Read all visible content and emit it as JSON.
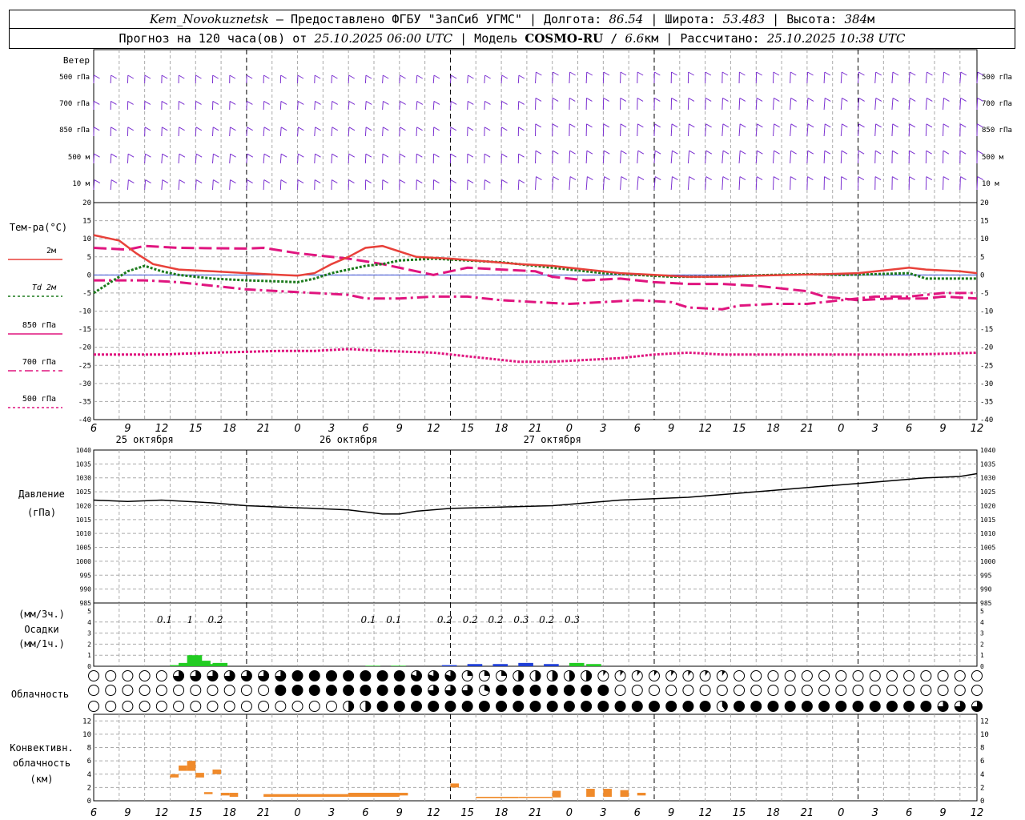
{
  "header": {
    "station": "Kem_Novokuznetsk",
    "provider": " — Предоставлено ФГБУ \"ЗапСиб УГМС\" | Долгота: ",
    "lon": "86.54",
    "lat_label": " | Широта: ",
    "lat": "53.483",
    "alt_label": " | Высота: ",
    "alt": "384",
    "alt_unit": "м",
    "line2_a": "Прогноз на 120 часа(ов) от ",
    "run_time": "25.10.2025 06:00 UTC",
    "line2_b": "  | Модель ",
    "model": "COSMO-RU",
    "line2_c": " / ",
    "res": "6.6",
    "res_unit": "км",
    "line2_d": " | Рассчитано: ",
    "calc_time": "25.10.2025 10:38 UTC"
  },
  "wind_panel": {
    "title": "Ветер",
    "levels": [
      "500 гПа",
      "700 гПа",
      "850 гПа",
      "500 м",
      "10 м"
    ],
    "color": "#7a2fd0"
  },
  "temp_panel": {
    "title": "Тем-ра(°C)",
    "ylim": [
      -40,
      20
    ],
    "ticks": [
      "20",
      "15",
      "10",
      "5",
      "0",
      "-5",
      "-10",
      "-15",
      "-20",
      "-25",
      "-30",
      "-35",
      "-40"
    ],
    "legend": [
      {
        "label": "2м",
        "prefix": "",
        "color": "#e8413a",
        "dash": "solid"
      },
      {
        "label": "2м",
        "prefix": "Td",
        "color": "#1c7a1c",
        "dash": "dot"
      },
      {
        "label": "гПа",
        "prefix": "850",
        "color": "#e0157f",
        "dash": "solid"
      },
      {
        "label": "гПа",
        "prefix": "700",
        "color": "#e0157f",
        "dash": "dashdot"
      },
      {
        "label": "гПа",
        "prefix": "500",
        "color": "#e0157f",
        "dash": "dot"
      }
    ]
  },
  "time_axis": {
    "hour_ticks": [
      "6",
      "9",
      "12",
      "15",
      "18",
      "21",
      "0",
      "3",
      "6",
      "9",
      "12",
      "15",
      "18",
      "21",
      "0",
      "3",
      "6",
      "9",
      "12",
      "15",
      "18",
      "21",
      "0",
      "3",
      "6",
      "9",
      "12"
    ],
    "days": [
      "25 октября",
      "26 октября",
      "27 октября"
    ]
  },
  "pressure_panel": {
    "title1": "Давление",
    "title2": "(гПа)",
    "ylim": [
      985,
      1040
    ],
    "ticks": [
      "1040",
      "1035",
      "1030",
      "1025",
      "1020",
      "1015",
      "1010",
      "1005",
      "1000",
      "995",
      "990",
      "985"
    ]
  },
  "precip_panel": {
    "title1": "(мм/3ч.)",
    "title2": "Осадки",
    "title3": "(мм/1ч.)",
    "ticks": [
      "5",
      "4",
      "3",
      "2",
      "1",
      "0"
    ],
    "amounts": [
      {
        "t": 9,
        "text": "0.1"
      },
      {
        "t": 12,
        "text": "1"
      },
      {
        "t": 15,
        "text": "0.2"
      },
      {
        "t": 33,
        "text": "0.1"
      },
      {
        "t": 36,
        "text": "0.1"
      },
      {
        "t": 42,
        "text": "0.2"
      },
      {
        "t": 45,
        "text": "0.2"
      },
      {
        "t": 48,
        "text": "0.2"
      },
      {
        "t": 51,
        "text": "0.3"
      },
      {
        "t": 54,
        "text": "0.2"
      },
      {
        "t": 57,
        "text": "0.3"
      }
    ]
  },
  "cloud_panel": {
    "title": "Облачность"
  },
  "conv_panel": {
    "title1": "Конвективн.",
    "title2": "облачность",
    "title3": "(км)",
    "ticks": [
      "12",
      "10",
      "8",
      "6",
      "4",
      "2",
      "0"
    ],
    "ylim": [
      0,
      13
    ]
  },
  "chart_data": {
    "type": "line",
    "x_unit": "hours since 25.10.2025 06:00 UTC",
    "temperature": {
      "t2m": [
        [
          0,
          11
        ],
        [
          3,
          9.5
        ],
        [
          5,
          6
        ],
        [
          7,
          3
        ],
        [
          10,
          1.5
        ],
        [
          14,
          1
        ],
        [
          18,
          0.5
        ],
        [
          22,
          0
        ],
        [
          24,
          -0.2
        ],
        [
          26,
          0.5
        ],
        [
          28,
          3
        ],
        [
          30,
          5
        ],
        [
          32,
          7.5
        ],
        [
          34,
          8
        ],
        [
          36,
          6.5
        ],
        [
          38,
          5
        ],
        [
          42,
          4.5
        ],
        [
          46,
          3.8
        ],
        [
          50,
          3
        ],
        [
          54,
          2.5
        ],
        [
          58,
          1.5
        ],
        [
          62,
          0.5
        ],
        [
          66,
          0
        ],
        [
          70,
          -0.5
        ],
        [
          74,
          -0.5
        ],
        [
          78,
          -0.2
        ],
        [
          82,
          0
        ],
        [
          86,
          0.2
        ],
        [
          90,
          0.5
        ],
        [
          94,
          1.5
        ],
        [
          96,
          2
        ],
        [
          98,
          1.5
        ],
        [
          102,
          1
        ],
        [
          104,
          0.5
        ]
      ],
      "td2m": [
        [
          0,
          -5
        ],
        [
          2,
          -2
        ],
        [
          4,
          1
        ],
        [
          6,
          2.5
        ],
        [
          8,
          1
        ],
        [
          10,
          0
        ],
        [
          14,
          -1
        ],
        [
          18,
          -1.5
        ],
        [
          22,
          -1.8
        ],
        [
          24,
          -2
        ],
        [
          26,
          -1
        ],
        [
          28,
          0.5
        ],
        [
          30,
          1.5
        ],
        [
          32,
          2.5
        ],
        [
          34,
          3
        ],
        [
          36,
          4
        ],
        [
          40,
          4.5
        ],
        [
          44,
          4
        ],
        [
          48,
          3.5
        ],
        [
          52,
          2.5
        ],
        [
          56,
          1.5
        ],
        [
          60,
          0.5
        ],
        [
          64,
          0
        ],
        [
          68,
          -0.5
        ],
        [
          72,
          -0.5
        ],
        [
          76,
          -0.2
        ],
        [
          80,
          0
        ],
        [
          84,
          0.2
        ],
        [
          88,
          0
        ],
        [
          92,
          0.2
        ],
        [
          96,
          0.5
        ],
        [
          98,
          -1
        ],
        [
          104,
          -1
        ]
      ],
      "t850": [
        [
          0,
          7.5
        ],
        [
          4,
          7
        ],
        [
          6,
          8
        ],
        [
          10,
          7.5
        ],
        [
          18,
          7.3
        ],
        [
          20,
          7.5
        ],
        [
          24,
          6
        ],
        [
          28,
          5
        ],
        [
          30,
          4.5
        ],
        [
          34,
          3
        ],
        [
          38,
          1
        ],
        [
          40,
          0
        ],
        [
          44,
          2
        ],
        [
          48,
          1.5
        ],
        [
          52,
          1
        ],
        [
          54,
          -0.5
        ],
        [
          58,
          -1.5
        ],
        [
          62,
          -1
        ],
        [
          66,
          -2
        ],
        [
          70,
          -2.5
        ],
        [
          74,
          -2.5
        ],
        [
          78,
          -3
        ],
        [
          80,
          -3.5
        ],
        [
          84,
          -4.5
        ],
        [
          86,
          -6
        ],
        [
          90,
          -7
        ],
        [
          94,
          -6.5
        ],
        [
          98,
          -6.5
        ],
        [
          100,
          -6
        ],
        [
          104,
          -6.5
        ]
      ],
      "t700": [
        [
          0,
          -1.5
        ],
        [
          6,
          -1.5
        ],
        [
          10,
          -2
        ],
        [
          14,
          -3
        ],
        [
          18,
          -4
        ],
        [
          22,
          -4.5
        ],
        [
          26,
          -5
        ],
        [
          30,
          -5.5
        ],
        [
          32,
          -6.5
        ],
        [
          36,
          -6.5
        ],
        [
          40,
          -6
        ],
        [
          44,
          -6
        ],
        [
          48,
          -7
        ],
        [
          52,
          -7.5
        ],
        [
          56,
          -8
        ],
        [
          60,
          -7.5
        ],
        [
          64,
          -7
        ],
        [
          68,
          -7.5
        ],
        [
          70,
          -9
        ],
        [
          74,
          -9.5
        ],
        [
          76,
          -8.5
        ],
        [
          80,
          -8
        ],
        [
          84,
          -8
        ],
        [
          88,
          -7
        ],
        [
          92,
          -6
        ],
        [
          96,
          -6
        ],
        [
          100,
          -5
        ],
        [
          104,
          -5
        ]
      ],
      "t500": [
        [
          0,
          -22
        ],
        [
          8,
          -22
        ],
        [
          14,
          -21.5
        ],
        [
          22,
          -21
        ],
        [
          26,
          -21
        ],
        [
          30,
          -20.5
        ],
        [
          34,
          -21
        ],
        [
          40,
          -21.5
        ],
        [
          46,
          -23
        ],
        [
          50,
          -24
        ],
        [
          54,
          -24
        ],
        [
          58,
          -23.5
        ],
        [
          62,
          -23
        ],
        [
          66,
          -22
        ],
        [
          70,
          -21.5
        ],
        [
          74,
          -22
        ],
        [
          80,
          -22
        ],
        [
          88,
          -22
        ],
        [
          92,
          -22
        ],
        [
          96,
          -22
        ],
        [
          100,
          -21.8
        ],
        [
          104,
          -21.5
        ]
      ]
    },
    "pressure": [
      [
        0,
        1022
      ],
      [
        4,
        1021.5
      ],
      [
        8,
        1022
      ],
      [
        14,
        1021
      ],
      [
        18,
        1020
      ],
      [
        22,
        1019.5
      ],
      [
        26,
        1019
      ],
      [
        30,
        1018.5
      ],
      [
        34,
        1017
      ],
      [
        36,
        1017
      ],
      [
        38,
        1018
      ],
      [
        42,
        1019
      ],
      [
        48,
        1019.5
      ],
      [
        54,
        1020
      ],
      [
        58,
        1021
      ],
      [
        62,
        1022
      ],
      [
        66,
        1022.5
      ],
      [
        70,
        1023
      ],
      [
        74,
        1024
      ],
      [
        78,
        1025
      ],
      [
        82,
        1026
      ],
      [
        86,
        1027
      ],
      [
        90,
        1028
      ],
      [
        94,
        1029
      ],
      [
        98,
        1030
      ],
      [
        102,
        1030.5
      ],
      [
        104,
        1031.5
      ]
    ],
    "precip_hourly": [
      [
        10,
        0.1
      ],
      [
        11,
        0.3
      ],
      [
        12,
        1
      ],
      [
        13,
        0.5
      ],
      [
        14,
        0.2
      ],
      [
        15,
        0.3
      ],
      [
        33,
        0.05
      ],
      [
        36,
        0.05
      ],
      [
        42,
        0.1
      ],
      [
        45,
        0.2
      ],
      [
        48,
        0.2
      ],
      [
        51,
        0.3
      ],
      [
        54,
        0.2
      ],
      [
        57,
        0.3
      ],
      [
        59,
        0.2
      ]
    ],
    "precip_colors": {
      "rain": "#22cc22",
      "snow": "#1f3fd6"
    },
    "conv_cloud_km": [
      [
        9,
        3.5,
        4
      ],
      [
        10,
        4.5,
        5.3
      ],
      [
        11,
        4.5,
        6
      ],
      [
        12,
        3.5,
        4.2
      ],
      [
        14,
        4,
        4.7
      ],
      [
        13,
        1,
        1.3
      ],
      [
        15,
        0.8,
        1.2
      ],
      [
        16,
        0.6,
        1.2
      ],
      [
        20,
        0.6,
        1.0
      ],
      [
        30,
        0.6,
        1.2
      ],
      [
        36,
        0.8,
        1.2
      ],
      [
        42,
        2,
        2.6
      ],
      [
        45,
        0.4,
        0.6
      ],
      [
        50,
        0.5,
        0.6
      ],
      [
        54,
        0.5,
        1.5
      ],
      [
        58,
        0.6,
        1.8
      ],
      [
        60,
        0.6,
        1.8
      ],
      [
        62,
        0.6,
        1.6
      ],
      [
        64,
        0.8,
        1.2
      ]
    ],
    "conv_color": "#f08a2a"
  }
}
